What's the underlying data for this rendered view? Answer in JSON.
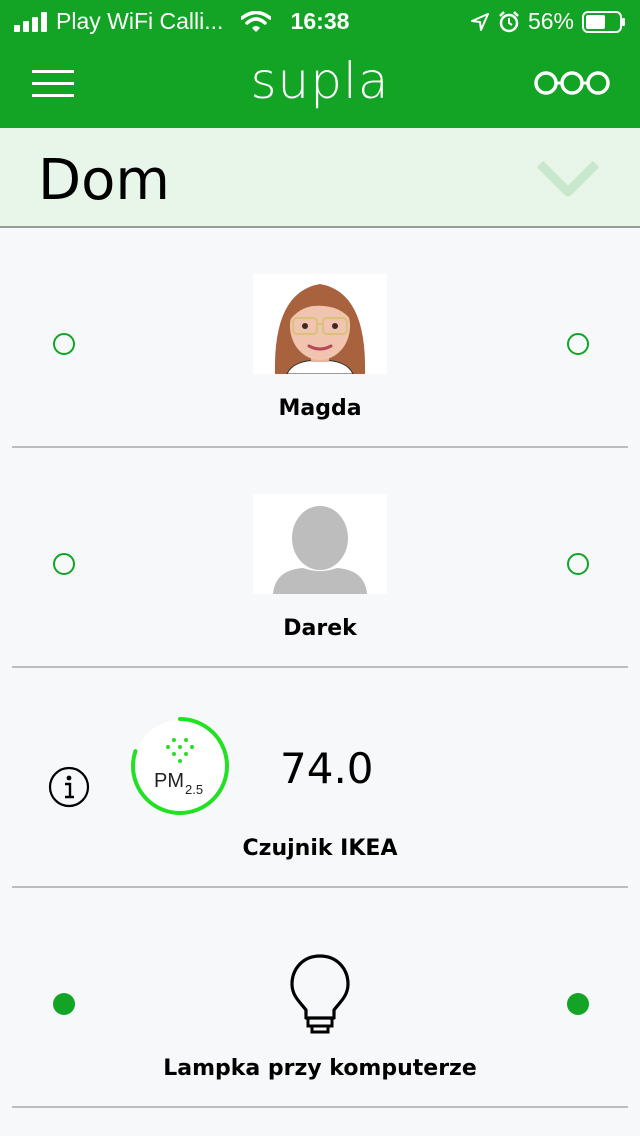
{
  "status_bar": {
    "carrier": "Play WiFi Calli...",
    "time": "16:38",
    "battery": "56%"
  },
  "header": {
    "title": "supla"
  },
  "location": {
    "name": "Dom"
  },
  "channels": [
    {
      "caption": "Magda",
      "left_indicator": "off",
      "right_indicator": "off",
      "icon": "memoji-avatar-image"
    },
    {
      "caption": "Darek",
      "left_indicator": "off",
      "right_indicator": "off",
      "icon": "person-placeholder-image"
    },
    {
      "caption": "Czujnik IKEA",
      "value": "74.0",
      "sensor_label": "PM",
      "sensor_sub": "2.5",
      "gauge_level": 0.8,
      "icon": "pm25-gauge-icon"
    },
    {
      "caption": "Lampka przy komputerze",
      "left_indicator": "on",
      "right_indicator": "on",
      "icon": "lightbulb-icon"
    }
  ],
  "colors": {
    "brand": "#13a426",
    "location_bg": "#e8f6ea",
    "chevron": "#c8e8cd",
    "gauge": "#22e022"
  }
}
